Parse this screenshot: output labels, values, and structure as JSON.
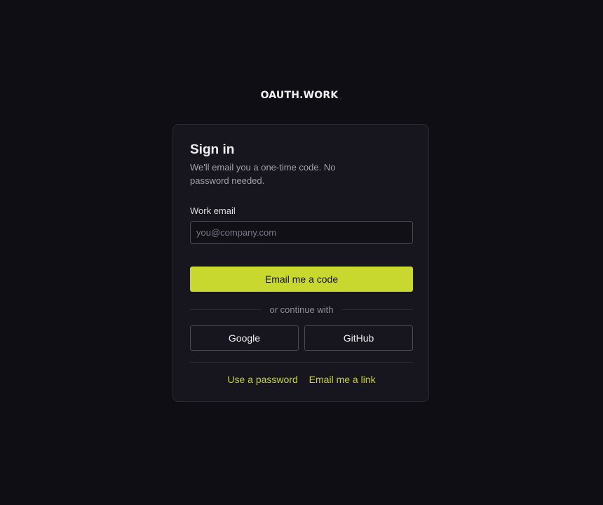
{
  "brand": {
    "name": "OAUTH.WORK"
  },
  "signin": {
    "title": "Sign in",
    "subtitle": "We'll email you a one-time code. No password needed.",
    "email_label": "Work email",
    "email_value": "",
    "email_placeholder": "you@company.com",
    "submit_label": "Email me a code",
    "divider_text": "or continue with",
    "oauth_providers": [
      {
        "label": "Google"
      },
      {
        "label": "GitHub"
      }
    ],
    "alt_links": [
      {
        "label": "Use a password"
      },
      {
        "label": "Email me a link"
      }
    ]
  },
  "colors": {
    "background": "#0e0e14",
    "card": "#17161e",
    "accent": "#c8d82e",
    "link": "#c6d22e"
  }
}
